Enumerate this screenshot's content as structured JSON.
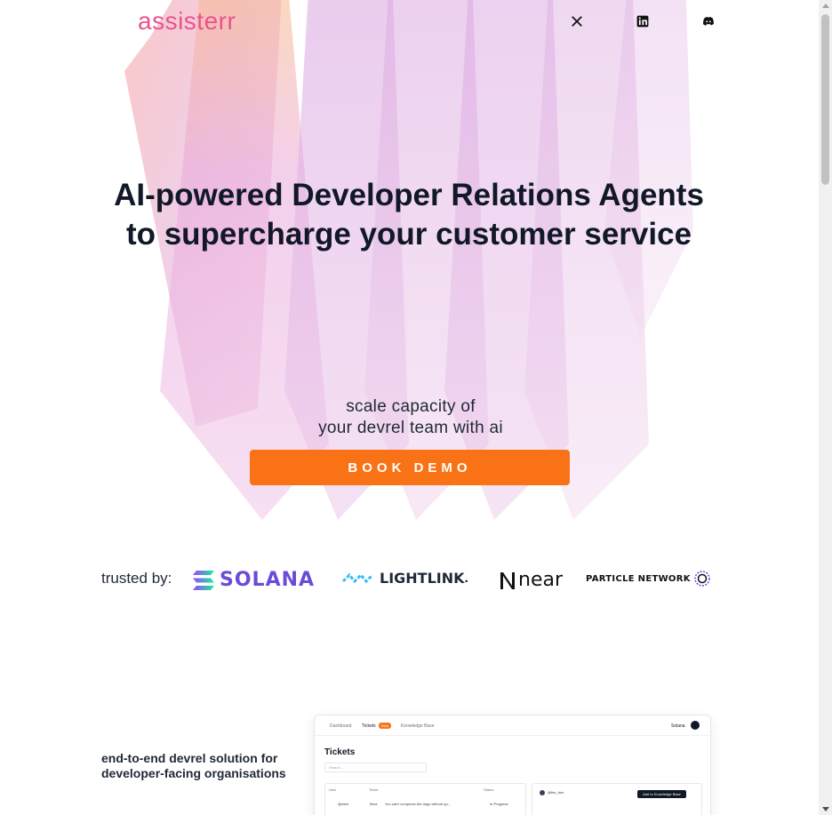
{
  "header": {
    "logo": "assisterr",
    "social": [
      {
        "name": "x-icon"
      },
      {
        "name": "linkedin-icon"
      },
      {
        "name": "discord-icon"
      }
    ]
  },
  "hero": {
    "headline_line1": "AI-powered Developer Relations Agents",
    "headline_line2": "to supercharge your customer service",
    "sub_line1": "scale capacity of",
    "sub_line2": "your devrel team with ai",
    "cta": "BOOK DEMO"
  },
  "trusted": {
    "label": "trusted by:",
    "brands": [
      "SOLANA",
      "LIGHTLINK",
      "near",
      "PARTICLE NETWORK"
    ]
  },
  "feature": {
    "text": "end-to-end devrel solution for developer-facing organisations"
  },
  "preview": {
    "nav": [
      "Dashboard",
      "Tickets",
      "Knowledge Base"
    ],
    "tickets_badge": "New",
    "org": "Solana",
    "title": "Tickets",
    "search_placeholder": "Search...",
    "columns": [
      "User",
      "Ticket",
      "Status"
    ],
    "row": {
      "user": "@mike",
      "ticket_id": "Bera",
      "ticket": "You can't compress the dapp without qu...",
      "status": "In Progress"
    },
    "panel_user": "@tim_tom",
    "panel_button": "Add to Knowledge Base"
  },
  "colors": {
    "accent": "#f97316",
    "logo": "#e8548f",
    "text": "#111827"
  }
}
